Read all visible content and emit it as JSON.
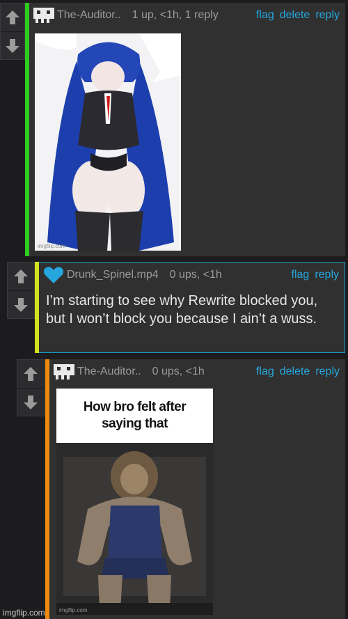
{
  "comments": [
    {
      "username": "The-Auditor..",
      "meta": "1 up, <1h, 1 reply",
      "actions": [
        "flag",
        "delete",
        "reply"
      ],
      "accent": "#2ecc1f",
      "avatar": "pixel-face-icon",
      "image_alt": "anime character in suit image",
      "image_watermark": "imgflip.com"
    },
    {
      "username": "Drunk_Spinel.mp4",
      "meta": "0 ups, <1h",
      "actions": [
        "flag",
        "reply"
      ],
      "accent": "#d4e21b",
      "avatar": "blue-heart-icon",
      "text": "I’m starting to see why Rewrite blocked you, but I won’t block you because I ain’t a wuss."
    },
    {
      "username": "The-Auditor..",
      "meta": "0 ups, <1h",
      "actions": [
        "flag",
        "delete",
        "reply"
      ],
      "accent": "#f08a0c",
      "avatar": "pixel-face-icon",
      "meme_caption": "How bro felt after saying that",
      "image_alt": "muscular lion sitting meme",
      "image_watermark": "imgflip.com"
    }
  ],
  "footer_watermark": "imgflip.com",
  "colors": {
    "link": "#25a7de",
    "background": "#1c1c1e",
    "panel": "#303030"
  }
}
